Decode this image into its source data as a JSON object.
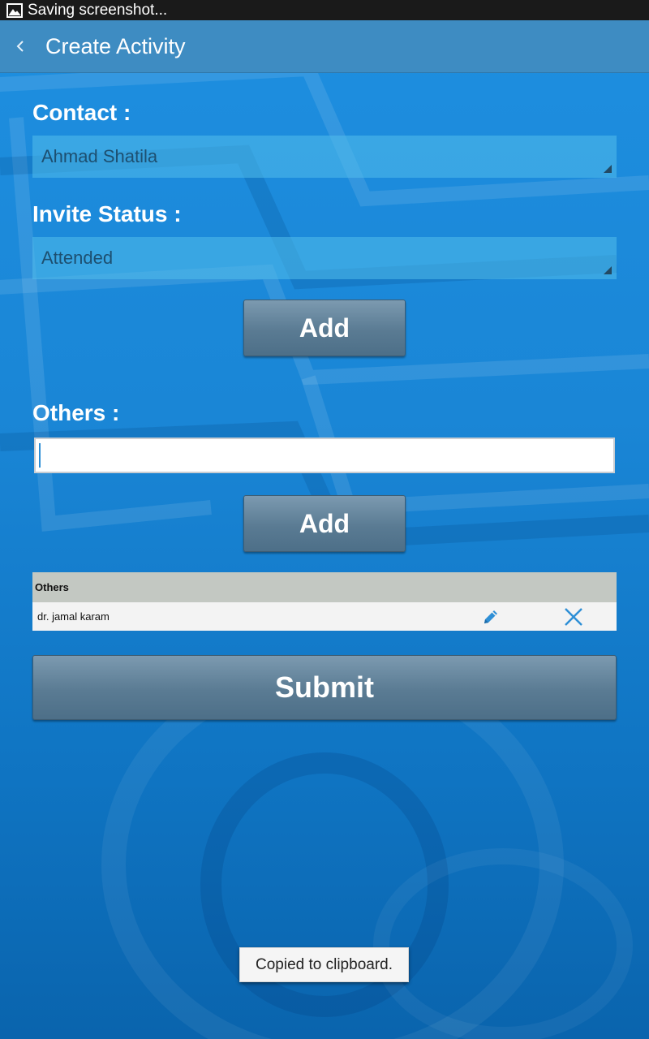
{
  "status_bar": {
    "notification_text": "Saving screenshot..."
  },
  "action_bar": {
    "back_icon": "chevron-left-icon",
    "title": "Create Activity"
  },
  "form": {
    "contact_label": "Contact :",
    "contact_value": "Ahmad Shatila",
    "invite_status_label": "Invite Status :",
    "invite_status_value": "Attended",
    "add_contact_button": "Add",
    "others_label": "Others :",
    "others_input_value": "",
    "add_others_button": "Add"
  },
  "others_table": {
    "header": "Others",
    "rows": [
      {
        "name": "dr. jamal karam",
        "edit_icon": "pencil-icon",
        "delete_icon": "close-icon"
      }
    ]
  },
  "submit_button": "Submit",
  "toast": "Copied to clipboard.",
  "colors": {
    "background": "#1a86d6",
    "action_bar": "#3e8cc2",
    "button": "#5a7b93",
    "spinner": "#52beeb",
    "icon_accent": "#2e8fd6"
  }
}
